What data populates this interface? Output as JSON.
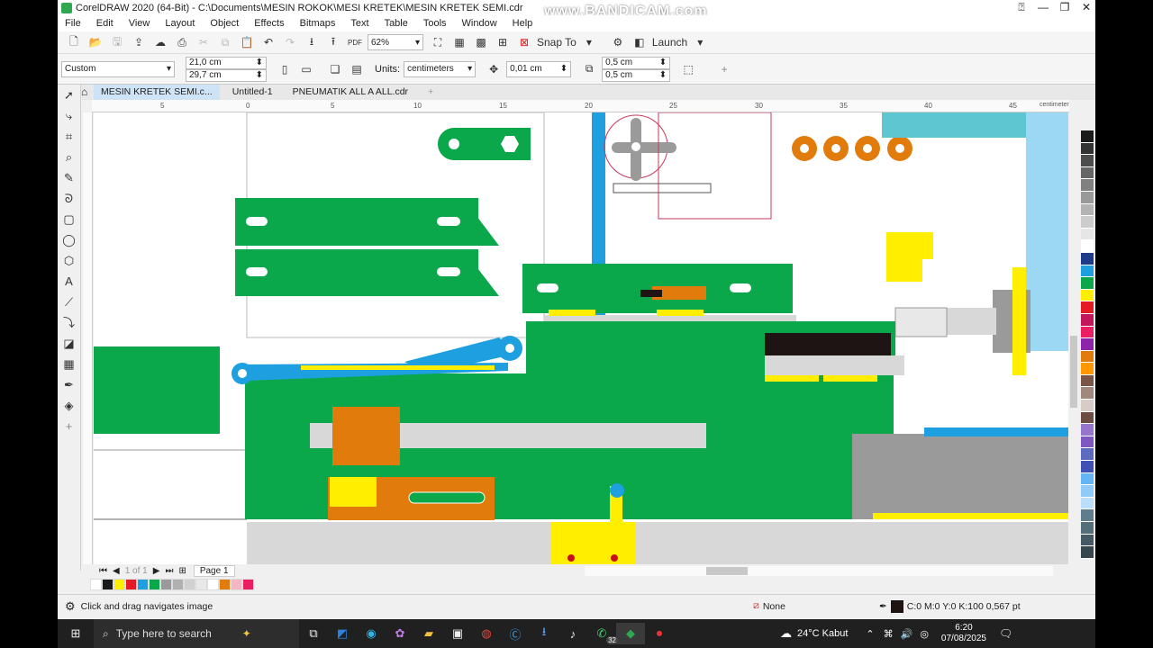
{
  "window": {
    "title": "CorelDRAW 2020 (64-Bit) - C:\\Documents\\MESIN ROKOK\\MESI KRETEK\\MESIN KRETEK SEMI.cdr",
    "watermark": "www.BANDICAM.com"
  },
  "menu": [
    "File",
    "Edit",
    "View",
    "Layout",
    "Object",
    "Effects",
    "Bitmaps",
    "Text",
    "Table",
    "Tools",
    "Window",
    "Help"
  ],
  "toolbar": {
    "zoom": "62%",
    "snap_to": "Snap To",
    "launch": "Launch"
  },
  "propbar": {
    "preset": "Custom",
    "width": "21,0 cm",
    "height": "29,7 cm",
    "units_label": "Units:",
    "units": "centimeters",
    "nudge": "0,01 cm",
    "dup_x": "0,5 cm",
    "dup_y": "0,5 cm"
  },
  "tabs": [
    "MESIN KRETEK SEMI.c...",
    "Untitled-1",
    "PNEUMATIK ALL A ALL.cdr"
  ],
  "ruler": {
    "ticks": [
      "5",
      "0",
      "5",
      "10",
      "15",
      "20",
      "25",
      "30",
      "35",
      "40",
      "45"
    ],
    "unit": "centimeters"
  },
  "pagebar": {
    "counter": "1 of 1",
    "page_tab": "Page 1"
  },
  "status": {
    "hint": "Click and drag navigates image",
    "fill": "None",
    "outline": "C:0 M:0 Y:0 K:100  0,567 pt"
  },
  "taskbar": {
    "search_placeholder": "Type here to search",
    "whatsapp_badge": "32",
    "weather": "24°C  Kabut",
    "time": "6:20",
    "date": "07/08/2025"
  },
  "colors": {
    "green": "#0aa84a",
    "blue": "#1ea0e0",
    "yellow": "#ffee00",
    "orange": "#e07b0c",
    "gray": "#d8d8d8",
    "darkgray": "#9a9a9a",
    "black": "#1e1414",
    "lightblue": "#9cd8f4",
    "teal": "#5ec6d0",
    "pink": "#c8385a"
  },
  "palette_colors": [
    "#1a1a1a",
    "#333",
    "#4d4d4d",
    "#666",
    "#808080",
    "#999",
    "#b3b3b3",
    "#ccc",
    "#e6e6e6",
    "#fff",
    "#1e3a8a",
    "#1ea0e0",
    "#0aa84a",
    "#ffee00",
    "#e51b24",
    "#c2185b",
    "#e91e63",
    "#8e24aa",
    "#e07b0c",
    "#ff9800",
    "#795548",
    "#a1887f",
    "#d7ccc8",
    "#6d4c41",
    "#9575cd",
    "#7e57c2",
    "#5c6bc0",
    "#3f51b5",
    "#64b5f6",
    "#90caf9",
    "#bbdefb",
    "#607d8b",
    "#546e7a",
    "#455a64",
    "#37474f"
  ],
  "doc_palette": [
    "#fff",
    "#1a1a1a",
    "#ffee00",
    "#e51b24",
    "#1ea0e0",
    "#0aa84a",
    "#9a9a9a",
    "#b0b0b0",
    "#d0d0d0",
    "#e8e8e8",
    "#fff",
    "#e07b0c",
    "#f4b6c2",
    "#e91e63"
  ]
}
